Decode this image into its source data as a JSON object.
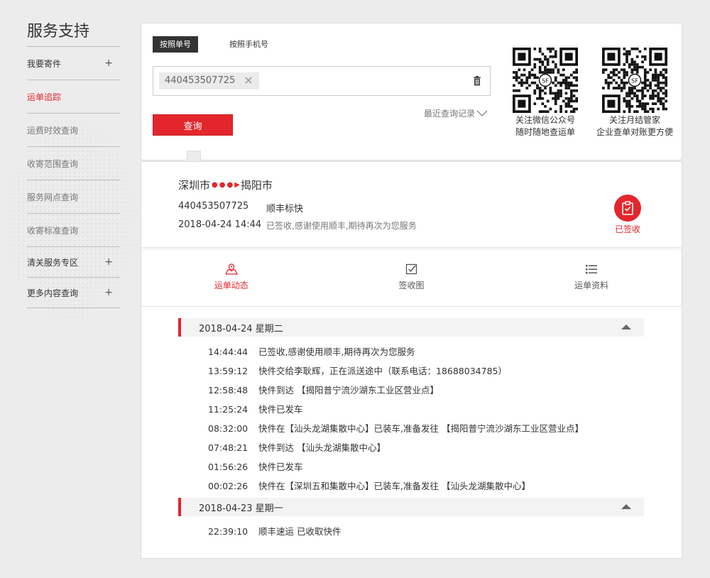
{
  "sidebar": {
    "title": "服务支持",
    "items": [
      {
        "label": "我要寄件",
        "plus": "+"
      },
      {
        "label": "运单追踪"
      },
      {
        "label": "运费时效查询"
      },
      {
        "label": "收寄范围查询"
      },
      {
        "label": "服务网点查询"
      },
      {
        "label": "收寄标准查询"
      },
      {
        "label": "清关服务专区",
        "plus": "+"
      },
      {
        "label": "更多内容查询",
        "plus": "+"
      }
    ]
  },
  "search": {
    "tab_waybill": "按照单号",
    "tab_phone": "按照手机号",
    "chip_value": "440453507725",
    "query_button": "查询",
    "recent_label": "最近查询记录",
    "qr1_caption_line1": "关注微信公众号",
    "qr1_caption_line2": "随时随地查运单",
    "qr2_caption_line1": "关注月结管家",
    "qr2_caption_line2": "企业查单对账更方便"
  },
  "result": {
    "from_city": "深圳市",
    "to_city": "揭阳市",
    "waybill_no": "440453507725",
    "service": "顺丰标快",
    "datetime": "2018-04-24 14:44",
    "status_text": "已签收,感谢使用顺丰,期待再次为您服务",
    "signed_label": "已签收",
    "subtabs": {
      "tracking": "运单动态",
      "receipt": "签收图",
      "info": "运单资料"
    },
    "days": [
      {
        "date": "2018-04-24 星期二",
        "events": [
          {
            "time": "14:44:44",
            "text": "已签收,感谢使用顺丰,期待再次为您服务"
          },
          {
            "time": "13:59:12",
            "text": "快件交给李耿辉，正在派送途中（联系电话：18688034785）"
          },
          {
            "time": "12:58:48",
            "text": "快件到达 【揭阳普宁流沙湖东工业区营业点】"
          },
          {
            "time": "11:25:24",
            "text": "快件已发车"
          },
          {
            "time": "08:32:00",
            "text": "快件在【汕头龙湖集散中心】已装车,准备发往 【揭阳普宁流沙湖东工业区营业点】"
          },
          {
            "time": "07:48:21",
            "text": "快件到达 【汕头龙湖集散中心】"
          },
          {
            "time": "01:56:26",
            "text": "快件已发车"
          },
          {
            "time": "00:02:26",
            "text": "快件在【深圳五和集散中心】已装车,准备发往 【汕头龙湖集散中心】"
          }
        ]
      },
      {
        "date": "2018-04-23 星期一",
        "events": [
          {
            "time": "22:39:10",
            "text": "顺丰速运 已收取快件"
          }
        ]
      }
    ]
  },
  "colors": {
    "accent": "#e3262c",
    "dark": "#333333"
  }
}
